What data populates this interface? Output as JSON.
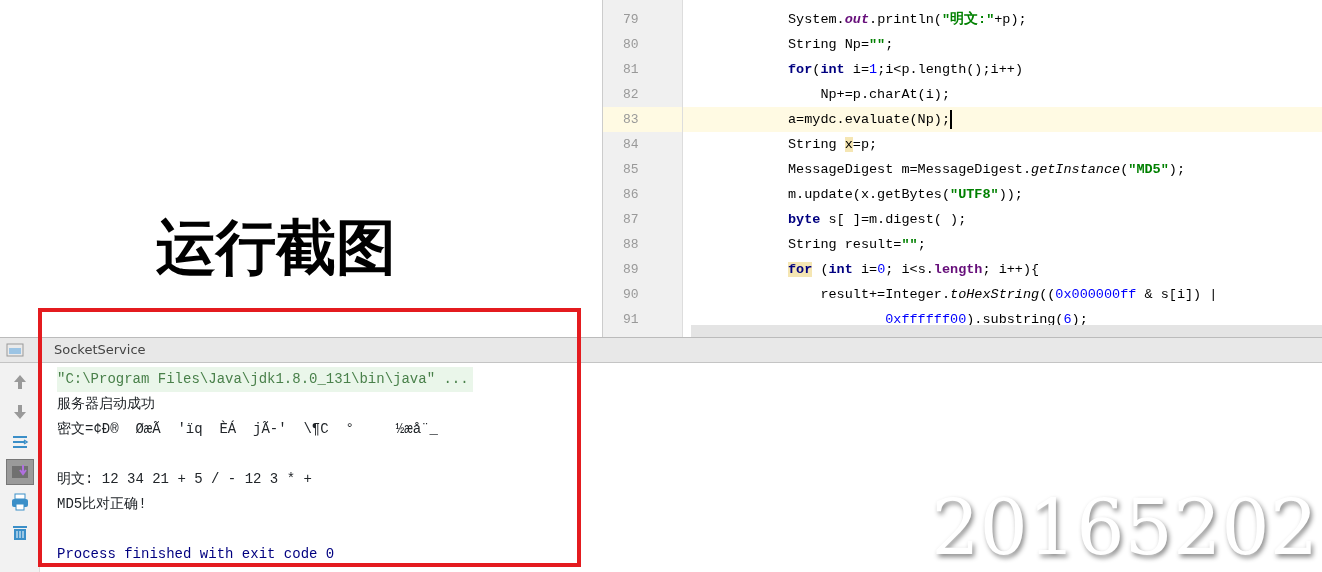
{
  "caption": "运行截图",
  "editor": {
    "lines": [
      {
        "number": "79",
        "current": false,
        "tokens": [
          {
            "text": "System.",
            "kind": "plain"
          },
          {
            "text": "out",
            "kind": "static"
          },
          {
            "text": ".println(",
            "kind": "plain"
          },
          {
            "text": "\"明文:\"",
            "kind": "string"
          },
          {
            "text": "+p);",
            "kind": "plain"
          }
        ]
      },
      {
        "number": "80",
        "current": false,
        "tokens": [
          {
            "text": "String Np=",
            "kind": "plain"
          },
          {
            "text": "\"\"",
            "kind": "string"
          },
          {
            "text": ";",
            "kind": "plain"
          }
        ]
      },
      {
        "number": "81",
        "current": false,
        "tokens": [
          {
            "text": "for",
            "kind": "keyword"
          },
          {
            "text": "(",
            "kind": "plain"
          },
          {
            "text": "int",
            "kind": "keyword"
          },
          {
            "text": " i=",
            "kind": "plain"
          },
          {
            "text": "1",
            "kind": "number"
          },
          {
            "text": ";i<p.length();i++)",
            "kind": "plain"
          }
        ]
      },
      {
        "number": "82",
        "current": false,
        "tokens": [
          {
            "text": "    Np+=p.charAt(i);",
            "kind": "plain"
          }
        ]
      },
      {
        "number": "83",
        "current": true,
        "tokens": [
          {
            "text": "a=mydc.evaluate(Np);",
            "kind": "plain"
          }
        ]
      },
      {
        "number": "84",
        "current": false,
        "tokens": [
          {
            "text": "String ",
            "kind": "plain"
          },
          {
            "text": "x",
            "kind": "plain",
            "marked": true
          },
          {
            "text": "=p;",
            "kind": "plain"
          }
        ]
      },
      {
        "number": "85",
        "current": false,
        "tokens": [
          {
            "text": "MessageDigest m=MessageDigest.",
            "kind": "plain"
          },
          {
            "text": "getInstance",
            "kind": "static-method"
          },
          {
            "text": "(",
            "kind": "plain"
          },
          {
            "text": "\"MD5\"",
            "kind": "string"
          },
          {
            "text": ");",
            "kind": "plain"
          }
        ]
      },
      {
        "number": "86",
        "current": false,
        "tokens": [
          {
            "text": "m.update(x.getBytes(",
            "kind": "plain"
          },
          {
            "text": "\"UTF8\"",
            "kind": "string"
          },
          {
            "text": "));",
            "kind": "plain"
          }
        ]
      },
      {
        "number": "87",
        "current": false,
        "tokens": [
          {
            "text": "byte",
            "kind": "keyword"
          },
          {
            "text": " s[ ]=m.digest( );",
            "kind": "plain"
          }
        ]
      },
      {
        "number": "88",
        "current": false,
        "tokens": [
          {
            "text": "String result=",
            "kind": "plain"
          },
          {
            "text": "\"\"",
            "kind": "string"
          },
          {
            "text": ";",
            "kind": "plain"
          }
        ]
      },
      {
        "number": "89",
        "current": false,
        "tokens": [
          {
            "text": "for",
            "kind": "keyword",
            "marked": true
          },
          {
            "text": " (",
            "kind": "plain"
          },
          {
            "text": "int",
            "kind": "keyword"
          },
          {
            "text": " i=",
            "kind": "plain"
          },
          {
            "text": "0",
            "kind": "number"
          },
          {
            "text": "; i<s.",
            "kind": "plain"
          },
          {
            "text": "length",
            "kind": "field"
          },
          {
            "text": "; i++){",
            "kind": "plain"
          }
        ]
      },
      {
        "number": "90",
        "current": false,
        "tokens": [
          {
            "text": "    result+=Integer.",
            "kind": "plain"
          },
          {
            "text": "toHexString",
            "kind": "static-method"
          },
          {
            "text": "((",
            "kind": "plain"
          },
          {
            "text": "0x000000ff",
            "kind": "number"
          },
          {
            "text": " & s[i]) |",
            "kind": "plain"
          }
        ]
      },
      {
        "number": "91",
        "current": false,
        "tokens": [
          {
            "text": "            0xffffff00",
            "kind": "number"
          },
          {
            "text": ").substring(",
            "kind": "plain"
          },
          {
            "text": "6",
            "kind": "number"
          },
          {
            "text": ");",
            "kind": "plain"
          }
        ]
      }
    ]
  },
  "console": {
    "title": "SocketService",
    "tools": [
      {
        "kind": "up",
        "selected": false
      },
      {
        "kind": "down",
        "selected": false
      },
      {
        "kind": "wrap",
        "selected": false
      },
      {
        "kind": "scroll-end",
        "selected": true
      },
      {
        "kind": "print",
        "selected": false
      },
      {
        "kind": "trash",
        "selected": false
      }
    ],
    "lines": [
      {
        "kind": "command",
        "blank_before": false,
        "text": "\"C:\\Program Files\\Java\\jdk1.8.0_131\\bin\\java\" ..."
      },
      {
        "kind": "output",
        "blank_before": false,
        "text": "服务器启动成功"
      },
      {
        "kind": "output",
        "blank_before": false,
        "text": "密文=¢Ð®  ØæÃ  'ïq  ÈÁ  jÃ-'  \\¶C  °     ½æå¨_"
      },
      {
        "kind": "output",
        "blank_before": true,
        "text": "明文: 12 34 21 + 5 / - 12 3 * +"
      },
      {
        "kind": "output",
        "blank_before": false,
        "text": "MD5比对正确!"
      },
      {
        "kind": "exit",
        "blank_before": true,
        "text": "Process finished with exit code 0"
      }
    ]
  },
  "stamp": "20165202"
}
